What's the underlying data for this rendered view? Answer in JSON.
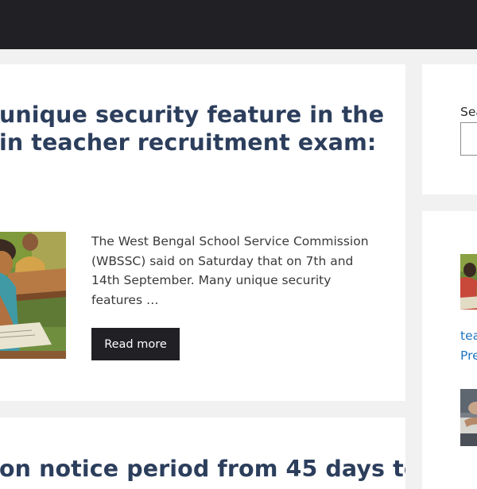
{
  "main_post": {
    "title_line_1": "unique security feature in the",
    "title_line_2": "in teacher recruitment exam:",
    "thumbnail": "students-writing-exam-illustration",
    "excerpt": "The West Bengal School Service Commission (WBSSC) said on Saturday that on 7th and 14th September. Many unique security features …",
    "read_more_label": "Read more"
  },
  "second_post": {
    "title_line_1": "on notice period from 45 days to"
  },
  "sidebar": {
    "search_label": "Sea",
    "search_value": "",
    "recent_posts": [
      {
        "thumbnail": "exam-hall-illustration",
        "link_text": "tea"
      },
      {
        "thumbnail": "",
        "link_text": "Pre"
      },
      {
        "thumbnail": "teacher-desk-photo",
        "link_text": ""
      }
    ]
  },
  "colors": {
    "topbar": "#212025",
    "title": "#2c3e5c",
    "button": "#212025",
    "link": "#1e73be"
  }
}
